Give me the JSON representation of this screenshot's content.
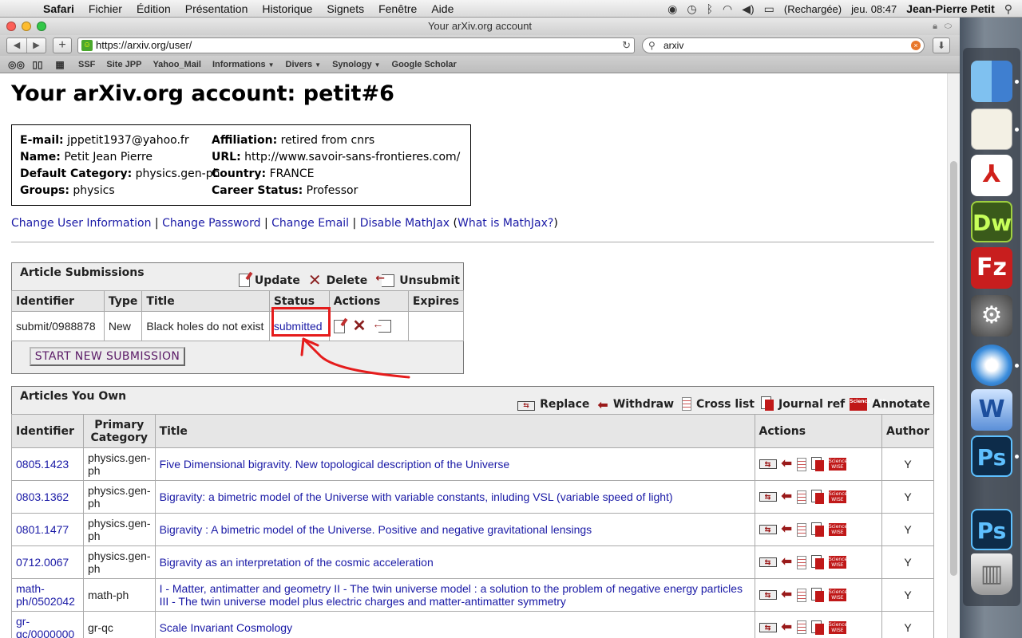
{
  "menubar": {
    "app": "Safari",
    "menus": [
      "Fichier",
      "Édition",
      "Présentation",
      "Historique",
      "Signets",
      "Fenêtre",
      "Aide"
    ],
    "battery": "(Rechargée)",
    "clock": "jeu. 08:47",
    "user": "Jean-Pierre Petit"
  },
  "browser": {
    "window_title": "Your arXiv.org account",
    "url": "https://arxiv.org/user/",
    "search": "arxiv",
    "bookmarks": [
      {
        "label": "SSF",
        "menu": false
      },
      {
        "label": "Site JPP",
        "menu": false
      },
      {
        "label": "Yahoo_Mail",
        "menu": false
      },
      {
        "label": "Informations",
        "menu": true
      },
      {
        "label": "Divers",
        "menu": true
      },
      {
        "label": "Synology",
        "menu": true
      },
      {
        "label": "Google Scholar",
        "menu": false
      }
    ]
  },
  "page": {
    "title": "Your arXiv.org account: petit#6",
    "info": {
      "email_label": "E-mail:",
      "email": "jppetit1937@yahoo.fr",
      "name_label": "Name:",
      "name": "Petit Jean Pierre",
      "category_label": "Default Category:",
      "category": "physics.gen-ph",
      "groups_label": "Groups:",
      "groups": "physics",
      "affiliation_label": "Affiliation:",
      "affiliation": "retired from cnrs",
      "url_label": "URL:",
      "url": "http://www.savoir-sans-frontieres.com/",
      "country_label": "Country:",
      "country": "FRANCE",
      "career_label": "Career Status:",
      "career": "Professor"
    },
    "links": {
      "change_info": "Change User Information",
      "change_password": "Change Password",
      "change_email": "Change Email",
      "disable_mathjax": "Disable MathJax",
      "what_mathjax": "What is MathJax?",
      "sep": "|"
    },
    "submissions": {
      "heading": "Article Submissions",
      "update": "Update",
      "delete": "Delete",
      "unsubmit": "Unsubmit",
      "columns": [
        "Identifier",
        "Type",
        "Title",
        "Status",
        "Actions",
        "Expires"
      ],
      "rows": [
        {
          "id": "submit/0988878",
          "type": "New",
          "title": "Black holes do not exist",
          "status": "submitted",
          "expires": ""
        }
      ],
      "start_button": "START NEW SUBMISSION"
    },
    "owned": {
      "heading": "Articles You Own",
      "replace": "Replace",
      "withdraw": "Withdraw",
      "cross_list": "Cross list",
      "journal_ref": "Journal ref",
      "annotate": "Annotate",
      "science_wise": "Science WISE",
      "columns": [
        "Identifier",
        "Primary Category",
        "Title",
        "Actions",
        "Author"
      ],
      "rows": [
        {
          "id": "0805.1423",
          "category": "physics.gen-ph",
          "title": "Five Dimensional bigravity. New topological description of the Universe",
          "author": "Y"
        },
        {
          "id": "0803.1362",
          "category": "physics.gen-ph",
          "title": "Bigravity: a bimetric model of the Universe with variable constants, inluding VSL (variable speed of light)",
          "author": "Y"
        },
        {
          "id": "0801.1477",
          "category": "physics.gen-ph",
          "title": "Bigravity : A bimetric model of the Universe. Positive and negative gravitational lensings",
          "author": "Y"
        },
        {
          "id": "0712.0067",
          "category": "physics.gen-ph",
          "title": "Bigravity as an interpretation of the cosmic acceleration",
          "author": "Y"
        },
        {
          "id": "math-ph/0502042",
          "category": "math-ph",
          "title": "I - Matter, antimatter and geometry II - The twin universe model : a solution to the problem of negative energy particles III - The twin universe model plus electric charges and matter-antimatter symmetry",
          "author": "Y"
        },
        {
          "id": "gr-qc/0000000",
          "category": "gr-qc",
          "title": "Scale Invariant Cosmology",
          "author": "Y"
        }
      ]
    }
  },
  "dock": {
    "items": [
      {
        "name": "finder",
        "label": ""
      },
      {
        "name": "textedit",
        "label": ""
      },
      {
        "name": "acrobat",
        "label": ""
      },
      {
        "name": "dreamweaver",
        "label": "Dw"
      },
      {
        "name": "filezilla",
        "label": "Fz"
      },
      {
        "name": "system-preferences",
        "label": ""
      },
      {
        "name": "safari",
        "label": ""
      },
      {
        "name": "word",
        "label": "W"
      },
      {
        "name": "photoshop",
        "label": "Ps"
      },
      {
        "name": "photoshop-2",
        "label": "Ps"
      },
      {
        "name": "trash",
        "label": ""
      }
    ]
  },
  "colors": {
    "link": "#1a1aa6",
    "annotation": "#e51c1c",
    "science_wise": "#c01818"
  }
}
